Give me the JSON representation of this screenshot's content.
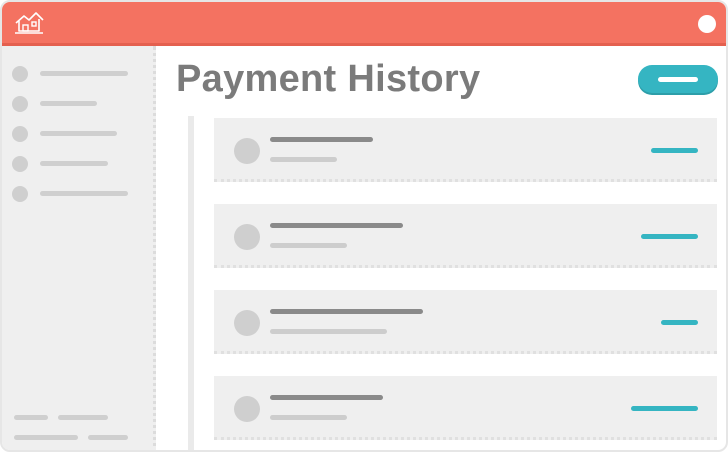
{
  "header": {
    "app_icon": "house-icon",
    "window_control": "circle-button",
    "accent_color": "#f47261"
  },
  "main": {
    "title": "Payment History",
    "primary_action_icon": "pill-button",
    "accent_color": "#35b5c2"
  }
}
